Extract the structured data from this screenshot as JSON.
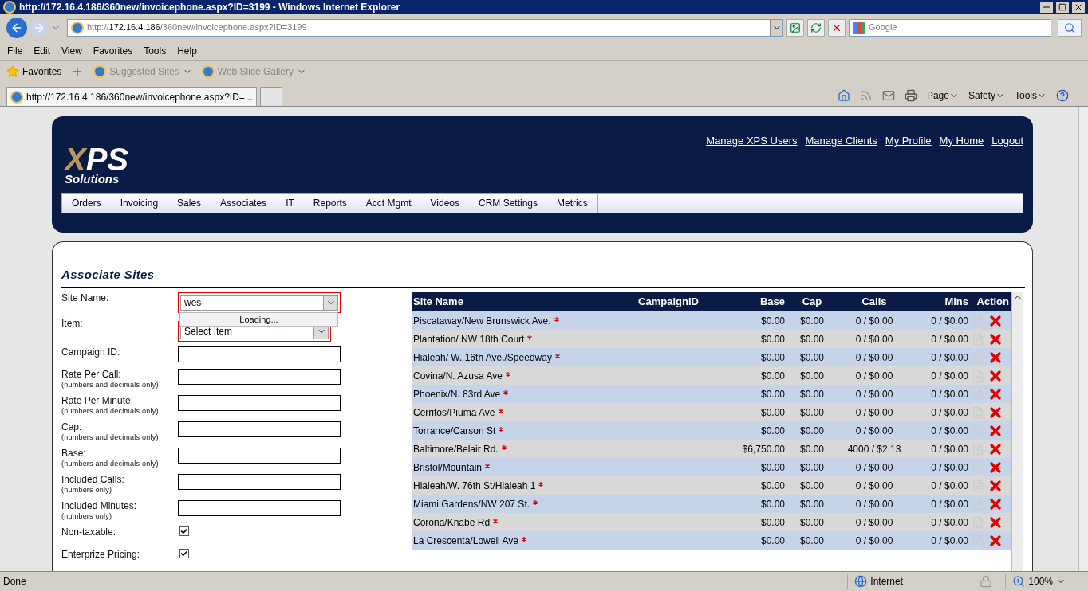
{
  "window": {
    "title": "http://172.16.4.186/360new/invoicephone.aspx?ID=3199 - Windows Internet Explorer"
  },
  "address_bar": {
    "scheme": "http://",
    "host": "172.16.4.186",
    "path": "/360new/invoicephone.aspx?ID=3199"
  },
  "search": {
    "placeholder": "Google"
  },
  "menu_bar": [
    "File",
    "Edit",
    "View",
    "Favorites",
    "Tools",
    "Help"
  ],
  "favorites_bar": [
    {
      "label": "Favorites",
      "kind": "star"
    },
    {
      "label": "Suggested Sites",
      "kind": "link"
    },
    {
      "label": "Web Slice Gallery",
      "kind": "link"
    }
  ],
  "tab": {
    "title": "http://172.16.4.186/360new/invoicephone.aspx?ID=..."
  },
  "command_bar": [
    "Page",
    "Safety",
    "Tools"
  ],
  "site": {
    "logo": {
      "word": "XPS",
      "tagline": "Solutions"
    },
    "top_links": [
      "Manage XPS Users",
      "Manage Clients",
      "My Profile",
      "My Home",
      "Logout"
    ],
    "nav": [
      "Orders",
      "Invoicing",
      "Sales",
      "Associates",
      "IT",
      "Reports",
      "Acct Mgmt",
      "Videos",
      "CRM Settings",
      "Metrics"
    ]
  },
  "form": {
    "title": "Associate Sites",
    "fields": [
      {
        "kind": "combo",
        "label": "Site Name:",
        "value": "wes",
        "dropdown": "Loading..."
      },
      {
        "kind": "select",
        "label": "Item:",
        "value": "Select Item"
      },
      {
        "kind": "text",
        "label": "Campaign ID:"
      },
      {
        "kind": "text",
        "label": "Rate Per Call:",
        "hint": "(numbers and decimals only)"
      },
      {
        "kind": "text",
        "label": "Rate Per Minute:",
        "hint": "(numbers and decimals only)"
      },
      {
        "kind": "text",
        "label": "Cap:",
        "hint": "(numbers and decimals only)"
      },
      {
        "kind": "text",
        "label": "Base:",
        "hint": "(numbers and decimals only)"
      },
      {
        "kind": "text",
        "label": "Included Calls:",
        "hint": "(numbers only)"
      },
      {
        "kind": "text",
        "label": "Included Minutes:",
        "hint": "(numbers only)"
      },
      {
        "kind": "checkbox",
        "label": "Non-taxable:",
        "checked": true
      },
      {
        "kind": "checkbox",
        "label": "Enterprize Pricing:",
        "checked": true
      }
    ]
  },
  "table": {
    "columns": [
      "Site Name",
      "CampaignID",
      "Base",
      "Cap",
      "Calls",
      "Mins",
      "Action"
    ],
    "rows": [
      {
        "site": "Piscataway/New Brunswick Ave.",
        "required": true,
        "base": "$0.00",
        "cap": "$0.00",
        "calls": "0 / $0.00",
        "mins": "0 / $0.00"
      },
      {
        "site": "Plantation/ NW 18th Court",
        "required": true,
        "base": "$0.00",
        "cap": "$0.00",
        "calls": "0 / $0.00",
        "mins": "0 / $0.00"
      },
      {
        "site": "Hialeah/ W. 16th Ave./Speedway",
        "required": true,
        "base": "$0.00",
        "cap": "$0.00",
        "calls": "0 / $0.00",
        "mins": "0 / $0.00"
      },
      {
        "site": "Covina/N. Azusa Ave",
        "required": true,
        "base": "$0.00",
        "cap": "$0.00",
        "calls": "0 / $0.00",
        "mins": "0 / $0.00"
      },
      {
        "site": "Phoenix/N. 83rd Ave",
        "required": true,
        "base": "$0.00",
        "cap": "$0.00",
        "calls": "0 / $0.00",
        "mins": "0 / $0.00"
      },
      {
        "site": "Cerritos/Piuma Ave",
        "required": true,
        "base": "$0.00",
        "cap": "$0.00",
        "calls": "0 / $0.00",
        "mins": "0 / $0.00"
      },
      {
        "site": "Torrance/Carson St",
        "required": true,
        "base": "$0.00",
        "cap": "$0.00",
        "calls": "0 / $0.00",
        "mins": "0 / $0.00"
      },
      {
        "site": "Baltimore/Belair Rd.",
        "required": true,
        "base": "$6,750.00",
        "cap": "$0.00",
        "calls": "4000 / $2.13",
        "mins": "0 / $0.00"
      },
      {
        "site": "Bristol/Mountain",
        "required": true,
        "base": "$0.00",
        "cap": "$0.00",
        "calls": "0 / $0.00",
        "mins": "0 / $0.00"
      },
      {
        "site": "Hialeah/W. 76th St/Hialeah 1",
        "required": true,
        "base": "$0.00",
        "cap": "$0.00",
        "calls": "0 / $0.00",
        "mins": "0 / $0.00"
      },
      {
        "site": "Miami Gardens/NW 207 St.",
        "required": true,
        "base": "$0.00",
        "cap": "$0.00",
        "calls": "0 / $0.00",
        "mins": "0 / $0.00"
      },
      {
        "site": "Corona/Knabe Rd",
        "required": true,
        "base": "$0.00",
        "cap": "$0.00",
        "calls": "0 / $0.00",
        "mins": "0 / $0.00"
      },
      {
        "site": "La Crescenta/Lowell Ave",
        "required": true,
        "base": "$0.00",
        "cap": "$0.00",
        "calls": "0 / $0.00",
        "mins": "0 / $0.00"
      }
    ]
  },
  "status_bar": {
    "text": "Done",
    "zone": "Internet",
    "zoom": "100%"
  }
}
